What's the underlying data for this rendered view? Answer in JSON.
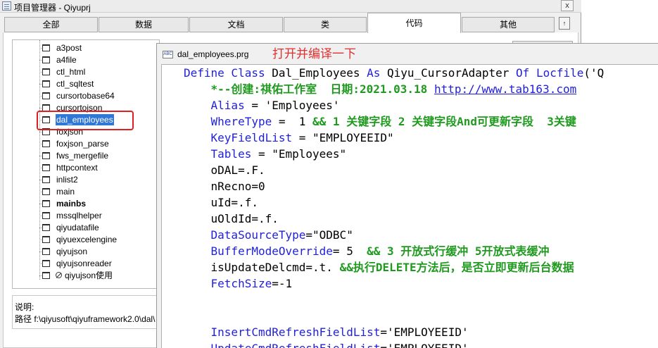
{
  "window": {
    "title": "项目管理器 - Qiyuprj",
    "close_label": "x"
  },
  "tabs": [
    {
      "label": "全部",
      "active": false
    },
    {
      "label": "数据",
      "active": false
    },
    {
      "label": "文档",
      "active": false
    },
    {
      "label": "类",
      "active": false
    },
    {
      "label": "代码",
      "active": true
    },
    {
      "label": "其他",
      "active": false
    }
  ],
  "tab_scroll_glyph": "↑",
  "tree": {
    "items": [
      {
        "label": "a3post",
        "state": "normal"
      },
      {
        "label": "a4file",
        "state": "normal"
      },
      {
        "label": "ctl_html",
        "state": "normal"
      },
      {
        "label": "ctl_sqltest",
        "state": "normal"
      },
      {
        "label": "cursortobase64",
        "state": "normal"
      },
      {
        "label": "cursortojson",
        "state": "normal"
      },
      {
        "label": "dal_employees",
        "state": "selected"
      },
      {
        "label": "foxjson",
        "state": "normal"
      },
      {
        "label": "foxjson_parse",
        "state": "normal"
      },
      {
        "label": "fws_mergefile",
        "state": "normal"
      },
      {
        "label": "httpcontext",
        "state": "normal"
      },
      {
        "label": "inlist2",
        "state": "normal"
      },
      {
        "label": "main",
        "state": "normal"
      },
      {
        "label": "mainbs",
        "state": "bold"
      },
      {
        "label": "mssqlhelper",
        "state": "normal"
      },
      {
        "label": "qiyudatafile",
        "state": "normal"
      },
      {
        "label": "qiyuexcelengine",
        "state": "normal"
      },
      {
        "label": "qiyujson",
        "state": "normal"
      },
      {
        "label": "qiyujsonreader",
        "state": "normal"
      },
      {
        "label": "qiyujson使用",
        "state": "excluded"
      }
    ]
  },
  "description": {
    "label": "说明:",
    "path": "路径 f:\\qiyusoft\\qiyuframework2.0\\dal\\"
  },
  "editor": {
    "title": "dal_employees.prg",
    "icon_text": "ABC",
    "annotation": "打开并编译一下",
    "lines": [
      [
        {
          "t": "Define Class ",
          "c": "kw"
        },
        {
          "t": "Dal_Employees ",
          "c": "plain"
        },
        {
          "t": "As ",
          "c": "kw"
        },
        {
          "t": "Qiyu_CursorAdapter ",
          "c": "plain"
        },
        {
          "t": "Of ",
          "c": "kw"
        },
        {
          "t": "Locfile",
          "c": "fn"
        },
        {
          "t": "('Q",
          "c": "plain"
        }
      ],
      [
        {
          "t": "    ",
          "c": "plain"
        },
        {
          "t": "*--创建:祺佑工作室  日期:2021.03.18 ",
          "c": "cm"
        },
        {
          "t": "http://www.tab163.com",
          "c": "lnk"
        }
      ],
      [
        {
          "t": "    ",
          "c": "plain"
        },
        {
          "t": "Alias",
          "c": "kw"
        },
        {
          "t": " = 'Employees'",
          "c": "plain"
        }
      ],
      [
        {
          "t": "    ",
          "c": "plain"
        },
        {
          "t": "WhereType",
          "c": "kw"
        },
        {
          "t": " =  1 ",
          "c": "plain"
        },
        {
          "t": "&& 1 关键字段 2 关键字段And可更新字段  3关键",
          "c": "cm"
        }
      ],
      [
        {
          "t": "    ",
          "c": "plain"
        },
        {
          "t": "KeyFieldList",
          "c": "kw"
        },
        {
          "t": " = \"EMPLOYEEID\"",
          "c": "plain"
        }
      ],
      [
        {
          "t": "    ",
          "c": "plain"
        },
        {
          "t": "Tables",
          "c": "kw"
        },
        {
          "t": " = \"Employees\"",
          "c": "plain"
        }
      ],
      [
        {
          "t": "    oDAL=.F.",
          "c": "plain"
        }
      ],
      [
        {
          "t": "    nRecno=0",
          "c": "plain"
        }
      ],
      [
        {
          "t": "    uId=.f.",
          "c": "plain"
        }
      ],
      [
        {
          "t": "    uOldId=.f.",
          "c": "plain"
        }
      ],
      [
        {
          "t": "    ",
          "c": "plain"
        },
        {
          "t": "DataSourceType",
          "c": "kw"
        },
        {
          "t": "=\"ODBC\"",
          "c": "plain"
        }
      ],
      [
        {
          "t": "    ",
          "c": "plain"
        },
        {
          "t": "BufferModeOverride",
          "c": "kw"
        },
        {
          "t": "= 5  ",
          "c": "plain"
        },
        {
          "t": "&& 3 开放式行缓冲 5开放式表缓冲",
          "c": "cm"
        }
      ],
      [
        {
          "t": "    isUpdateDelcmd=.t. ",
          "c": "plain"
        },
        {
          "t": "&&执行DELETE方法后，是否立即更新后台数据",
          "c": "cm"
        }
      ],
      [
        {
          "t": "    ",
          "c": "plain"
        },
        {
          "t": "FetchSize",
          "c": "kw"
        },
        {
          "t": "=-1",
          "c": "plain"
        }
      ],
      [
        {
          "t": "",
          "c": "plain"
        }
      ],
      [
        {
          "t": "",
          "c": "plain"
        }
      ],
      [
        {
          "t": "    ",
          "c": "plain"
        },
        {
          "t": "InsertCmdRefreshFieldList",
          "c": "kw"
        },
        {
          "t": "='EMPLOYEEID'",
          "c": "plain"
        }
      ],
      [
        {
          "t": "    ",
          "c": "plain"
        },
        {
          "t": "UpdateCmdRefreshFieldList",
          "c": "kw"
        },
        {
          "t": "='EMPLOYEEID'",
          "c": "plain"
        }
      ]
    ]
  }
}
